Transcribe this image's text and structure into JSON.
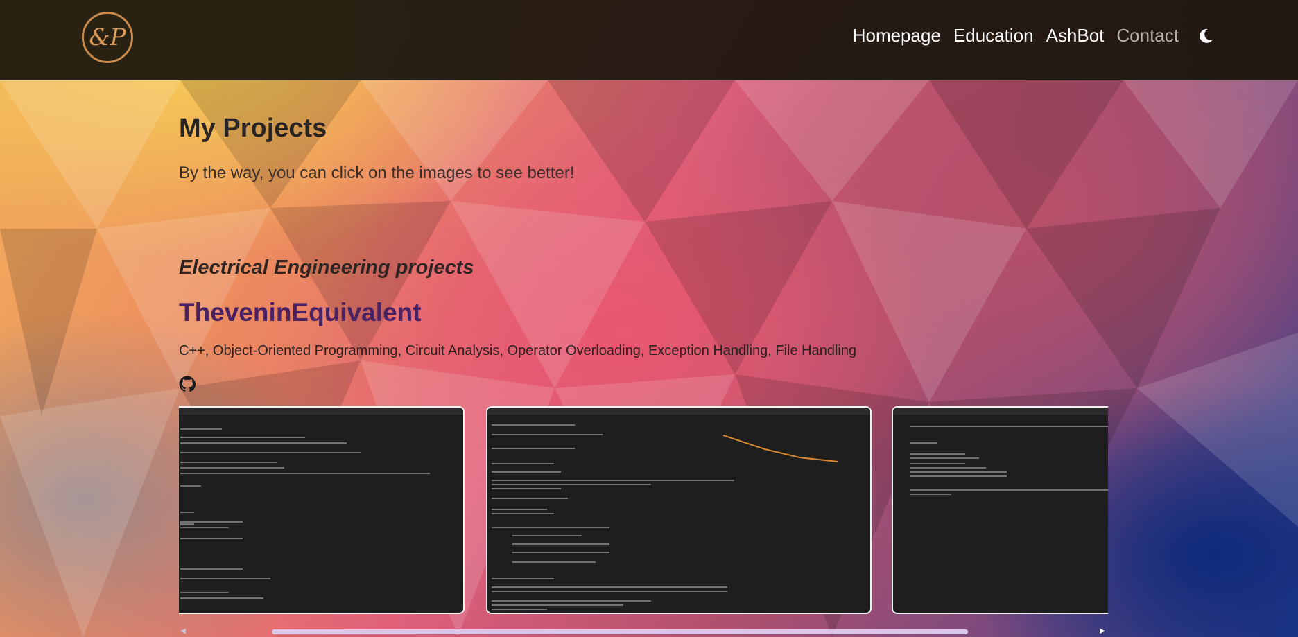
{
  "nav": {
    "logo_text": "&P",
    "items": [
      {
        "label": "Homepage"
      },
      {
        "label": "Education"
      },
      {
        "label": "AshBot"
      },
      {
        "label": "Contact"
      }
    ]
  },
  "main": {
    "title": "My Projects",
    "subtitle": "By the way, you can click on the images to see better!",
    "section_title": "Electrical Engineering projects",
    "project": {
      "name": "TheveninEquivalent",
      "tech": "C++, Object-Oriented Programming, Circuit Analysis, Operator Overloading, Exception Handling, File Handling"
    }
  },
  "icons": {
    "theme_toggle": "moon-icon",
    "repo_link": "github-icon"
  },
  "colors": {
    "navbar": "#1c160e",
    "project_title": "#4a2162",
    "scroll_thumb": "#dcc7ea"
  }
}
